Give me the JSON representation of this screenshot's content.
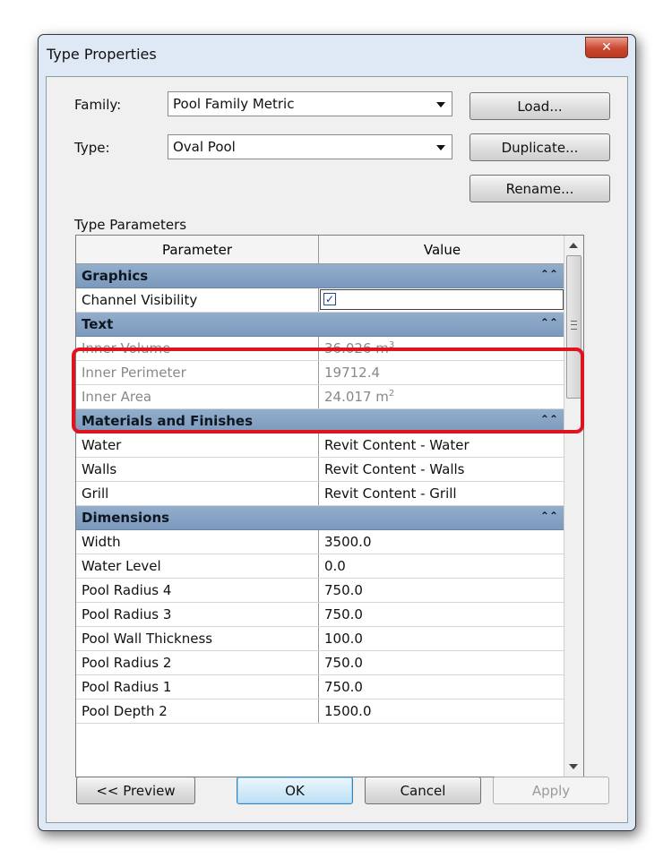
{
  "window": {
    "title": "Type Properties",
    "close_glyph": "✕"
  },
  "family": {
    "label": "Family:",
    "value": "Pool Family Metric"
  },
  "type": {
    "label": "Type:",
    "value": "Oval Pool"
  },
  "buttons": {
    "load": "Load...",
    "duplicate": "Duplicate...",
    "rename": "Rename..."
  },
  "section_label": "Type Parameters",
  "grid": {
    "col_parameter": "Parameter",
    "col_value": "Value",
    "collapse_glyph": "⌃⌃",
    "groups": [
      {
        "name": "Graphics",
        "rows": [
          {
            "param": "Channel Visibility",
            "checked": true
          }
        ]
      },
      {
        "name": "Text",
        "rows": [
          {
            "param": "Inner Volume",
            "value": "36.026 m",
            "sup": "3"
          },
          {
            "param": "Inner Perimeter",
            "value": "19712.4"
          },
          {
            "param": "Inner Area",
            "value": "24.017 m",
            "sup": "2"
          }
        ]
      },
      {
        "name": "Materials and Finishes",
        "rows": [
          {
            "param": "Water",
            "value": "Revit Content - Water"
          },
          {
            "param": "Walls",
            "value": "Revit Content - Walls"
          },
          {
            "param": "Grill",
            "value": "Revit Content - Grill"
          }
        ]
      },
      {
        "name": "Dimensions",
        "rows": [
          {
            "param": "Width",
            "value": "3500.0"
          },
          {
            "param": "Water Level",
            "value": "0.0"
          },
          {
            "param": "Pool Radius 4",
            "value": "750.0"
          },
          {
            "param": "Pool Radius 3",
            "value": "750.0"
          },
          {
            "param": "Pool Wall Thickness",
            "value": "100.0"
          },
          {
            "param": "Pool Radius 2",
            "value": "750.0"
          },
          {
            "param": "Pool Radius 1",
            "value": "750.0"
          },
          {
            "param": "Pool Depth 2",
            "value": "1500.0"
          }
        ]
      }
    ]
  },
  "footer": {
    "preview": "<< Preview",
    "ok": "OK",
    "cancel": "Cancel",
    "apply": "Apply"
  },
  "colors": {
    "group_header": "#7b99bd",
    "highlight": "#e0141f",
    "readonly_text": "#888888"
  }
}
